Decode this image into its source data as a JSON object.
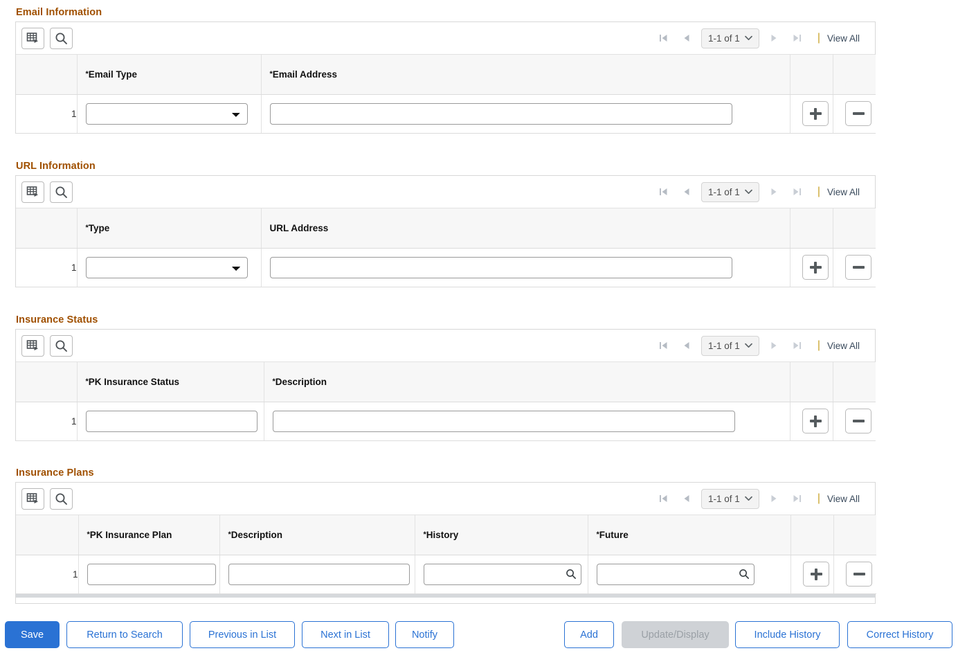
{
  "pager": {
    "count_label": "1-1 of 1",
    "view_all_label": "View All",
    "first_icon": "first-page-icon",
    "prev_icon": "previous-page-icon",
    "next_icon": "next-page-icon",
    "last_icon": "last-page-icon",
    "chevron_icon": "chevron-down-icon",
    "separator": "|"
  },
  "toolbar": {
    "download_icon": "grid-download-icon",
    "find_icon": "search-icon"
  },
  "row_actions": {
    "add_icon": "plus-icon",
    "delete_icon": "minus-icon"
  },
  "colors": {
    "section_header": "#a05000",
    "primary_button": "#2a72d4",
    "header_row": "#f7f7f7",
    "border": "#e2e2e2"
  },
  "sections": [
    {
      "title": "Email Information",
      "columns": [
        "",
        "*Email Type",
        "*Email Address",
        "",
        ""
      ],
      "row_number": "1",
      "fields": [
        {
          "kind": "select",
          "name": "email-type-select",
          "value": ""
        },
        {
          "kind": "text",
          "name": "email-address-input",
          "value": ""
        }
      ]
    },
    {
      "title": "URL Information",
      "columns": [
        "",
        "*Type",
        "URL Address",
        "",
        ""
      ],
      "row_number": "1",
      "fields": [
        {
          "kind": "select",
          "name": "url-type-select",
          "value": ""
        },
        {
          "kind": "text",
          "name": "url-address-input",
          "value": ""
        }
      ]
    },
    {
      "title": "Insurance Status",
      "columns": [
        "",
        "*PK Insurance Status",
        "*Description",
        "",
        ""
      ],
      "row_number": "1",
      "fields": [
        {
          "kind": "text",
          "name": "pk-insurance-status-input",
          "value": ""
        },
        {
          "kind": "text",
          "name": "insurance-status-description-input",
          "value": ""
        }
      ]
    },
    {
      "title": "Insurance Plans",
      "columns": [
        "",
        "*PK Insurance Plan",
        "*Description",
        "*History",
        "*Future",
        "",
        ""
      ],
      "row_number": "1",
      "fields": [
        {
          "kind": "text",
          "name": "pk-insurance-plan-input",
          "value": ""
        },
        {
          "kind": "text",
          "name": "insurance-plan-description-input",
          "value": ""
        },
        {
          "kind": "lookup",
          "name": "history-input",
          "value": ""
        },
        {
          "kind": "lookup",
          "name": "future-input",
          "value": ""
        }
      ]
    }
  ],
  "buttons": {
    "save": "Save",
    "return_to_search": "Return to Search",
    "previous_in_list": "Previous in List",
    "next_in_list": "Next in List",
    "notify": "Notify",
    "add": "Add",
    "update_display": "Update/Display",
    "include_history": "Include History",
    "correct_history": "Correct History"
  }
}
